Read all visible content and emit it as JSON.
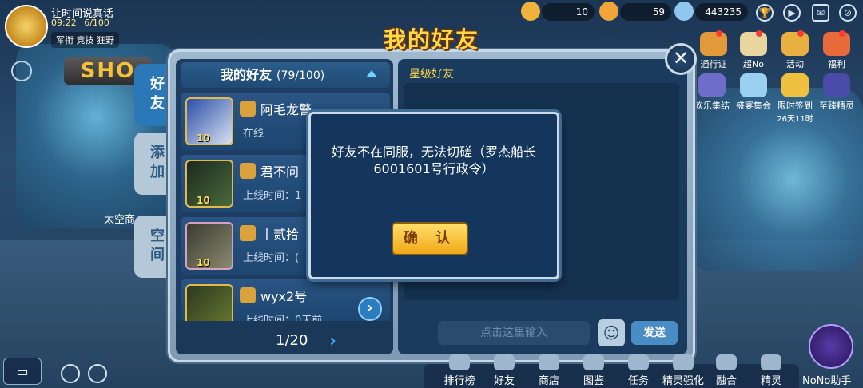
{
  "player": {
    "name": "让时间说真话",
    "time": "09:22",
    "stamina": "6/100",
    "tags": "军衔  竞技  狂野"
  },
  "resources": [
    {
      "value": "10",
      "color": "#f0b23a"
    },
    {
      "value": "59",
      "color": "#f0a43a"
    },
    {
      "value": "443235",
      "color": "#8fc7ef"
    }
  ],
  "right_icons": [
    {
      "label": "通行证",
      "dot": true
    },
    {
      "label": "超No",
      "dot": true
    },
    {
      "label": "活动",
      "dot": true
    },
    {
      "label": "福利",
      "dot": true
    },
    {
      "label": "欢乐集结",
      "dot": false
    },
    {
      "label": "盛宴集会",
      "dot": false
    },
    {
      "label": "限时签到",
      "sub": "26天11时",
      "dot": false
    },
    {
      "label": "至臻精灵",
      "dot": false
    }
  ],
  "background": {
    "shop_sign": "SHO",
    "label": "太空商"
  },
  "panel": {
    "title": "我的好友",
    "tabs": [
      "好友",
      "添加",
      "空间"
    ],
    "list_header": "我的好友",
    "list_count": "(79/100)",
    "friends": [
      {
        "name": "阿毛龙警",
        "status": "在线",
        "level": "10"
      },
      {
        "name": "君不问",
        "status": "上线时间：1",
        "level": "10"
      },
      {
        "name": "丨贰拾",
        "status": "上线时间：(",
        "level": "10"
      },
      {
        "name": "wyx2号",
        "status": "上线时间：0天前",
        "level": ""
      }
    ],
    "page": "1/20",
    "star_label": "星级好友",
    "input_placeholder": "点击这里输入",
    "send_label": "发送"
  },
  "modal": {
    "message": "好友不在同服，无法切磋（罗杰船长6001601号行政令）",
    "confirm_label": "确 认"
  },
  "bottom_nav": [
    "排行榜",
    "好友",
    "商店",
    "图鉴",
    "任务",
    "精灵强化",
    "融合",
    "精灵"
  ],
  "assistant_label": "NoNo助手"
}
